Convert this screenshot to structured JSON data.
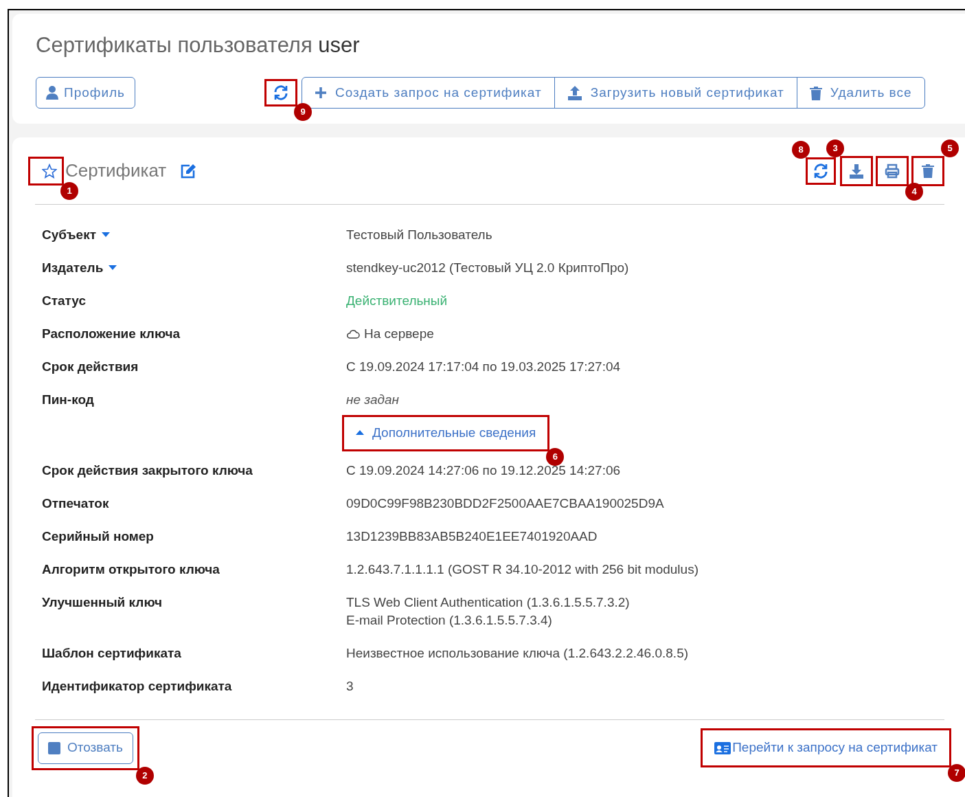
{
  "header": {
    "title": "Сертификаты пользователя",
    "user": "user"
  },
  "toolbar": {
    "profile": "Профиль",
    "actions": [
      {
        "kind": "create",
        "label": "Создать запрос на сертификат"
      },
      {
        "kind": "upload",
        "label": "Загрузить новый сертификат"
      },
      {
        "kind": "delete",
        "label": "Удалить все"
      }
    ]
  },
  "certificate": {
    "title": "Сертификат",
    "favorite": false,
    "rows": [
      {
        "label": "Субъект",
        "collapsible": true,
        "kind": "text",
        "values": [
          "Тестовый Пользователь"
        ]
      },
      {
        "label": "Издатель",
        "collapsible": true,
        "kind": "text",
        "values": [
          "stendkey-uc2012 (Тестовый УЦ 2.0 КриптоПро)"
        ]
      },
      {
        "label": "Статус",
        "collapsible": false,
        "kind": "status",
        "values": [
          "Действительный"
        ]
      },
      {
        "label": "Расположение ключа",
        "collapsible": false,
        "kind": "location",
        "values": [
          "На сервере"
        ]
      },
      {
        "label": "Срок действия",
        "collapsible": false,
        "kind": "text",
        "values": [
          "С 19.09.2024 17:17:04 по 19.03.2025 17:27:04"
        ]
      },
      {
        "label": "Пин-код",
        "collapsible": false,
        "kind": "muted",
        "values": [
          "не задан"
        ]
      }
    ],
    "details": {
      "label": "Дополнительные сведения",
      "expanded": true
    },
    "extra_rows": [
      {
        "label": "Срок действия закрытого ключа",
        "collapsible": false,
        "kind": "text",
        "values": [
          "С 19.09.2024 14:27:06 по 19.12.2025 14:27:06"
        ]
      },
      {
        "label": "Отпечаток",
        "collapsible": false,
        "kind": "text",
        "values": [
          "09D0C99F98B230BDD2F2500AAE7CBAA190025D9A"
        ]
      },
      {
        "label": "Серийный номер",
        "collapsible": false,
        "kind": "text",
        "values": [
          "13D1239BB83AB5B240E1EE7401920AAD"
        ]
      },
      {
        "label": "Алгоритм открытого ключа",
        "collapsible": false,
        "kind": "text",
        "values": [
          "1.2.643.7.1.1.1.1 (GOST R 34.10-2012 with 256 bit modulus)"
        ]
      },
      {
        "label": "Улучшенный ключ",
        "collapsible": false,
        "kind": "text",
        "values": [
          "TLS Web Client Authentication (1.3.6.1.5.5.7.3.2)",
          "E-mail Protection (1.3.6.1.5.5.7.3.4)"
        ]
      },
      {
        "label": "Шаблон сертификата",
        "collapsible": false,
        "kind": "text",
        "values": [
          "Неизвестное использование ключа (1.2.643.2.2.46.0.8.5)"
        ]
      },
      {
        "label": "Идентификатор сертификата",
        "collapsible": false,
        "kind": "text",
        "values": [
          "3"
        ]
      }
    ],
    "revoke": "Отозвать",
    "go_to_request": "Перейти к запросу на сертификат"
  },
  "annotations": [
    {
      "label": "9"
    },
    {
      "label": "1"
    },
    {
      "label": "8"
    },
    {
      "label": "3"
    },
    {
      "label": "5"
    },
    {
      "label": "4"
    },
    {
      "label": "6"
    },
    {
      "label": "2"
    },
    {
      "label": "7"
    }
  ]
}
